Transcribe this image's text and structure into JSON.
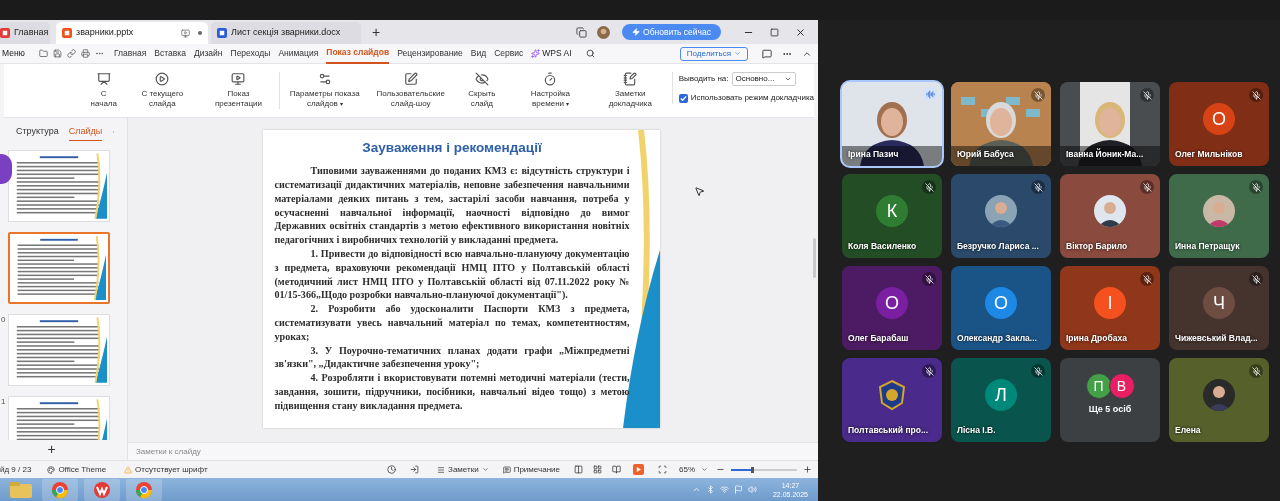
{
  "window_tabs": [
    {
      "label": "Главная",
      "selected": false,
      "kind": "wps"
    },
    {
      "label": "зварники.pptx",
      "selected": true,
      "kind": "pptx"
    },
    {
      "label": "Лист секція зварники.docx",
      "selected": false,
      "kind": "docx"
    }
  ],
  "new_tab": "+",
  "update_button": "Обновить сейчас",
  "menu_button": "Меню",
  "ribbon_tabs": [
    {
      "label": "Главная",
      "selected": false
    },
    {
      "label": "Вставка",
      "selected": false
    },
    {
      "label": "Дизайн",
      "selected": false
    },
    {
      "label": "Переходы",
      "selected": false
    },
    {
      "label": "Анимация",
      "selected": false
    },
    {
      "label": "Показ слайдов",
      "selected": true
    },
    {
      "label": "Рецензирование",
      "selected": false
    },
    {
      "label": "Вид",
      "selected": false
    },
    {
      "label": "Сервис",
      "selected": false
    }
  ],
  "ai_button": "WPS AI",
  "share_button": "Поделиться",
  "ribbon_groups": [
    [
      {
        "label": "С начала",
        "kind": "from-start"
      },
      {
        "label": "С текущего слайда",
        "kind": "from-current"
      },
      {
        "label": "Показ презентации",
        "kind": "present"
      }
    ],
    [
      {
        "label": "Параметры показа слайдов",
        "kind": "settings",
        "dropdown_mark": "▾"
      },
      {
        "label": "Пользовательские слайд-шоу",
        "kind": "custom"
      },
      {
        "label": "Скрыть слайд",
        "kind": "hide"
      },
      {
        "label": "Настройка времени",
        "kind": "timing",
        "dropdown_mark": "▾"
      },
      {
        "label": "Заметки докладчика",
        "kind": "notes"
      }
    ]
  ],
  "output": {
    "label": "Выводить на:",
    "value": "Основно..."
  },
  "presenter_mode": {
    "label": "Использовать режим докладчика",
    "checked": true
  },
  "panel_tabs": [
    {
      "label": "Структура",
      "selected": false
    },
    {
      "label": "Слайды",
      "selected": true
    }
  ],
  "thumbnails": [
    {
      "selected": false
    },
    {
      "selected": true
    },
    {
      "number": "0",
      "selected": false
    },
    {
      "number": "1",
      "selected": false
    }
  ],
  "add_slide": "+",
  "slide": {
    "title": "Зауваження і рекомендації",
    "paragraphs": [
      "Типовими зауваженнями до поданих КМЗ є: відсутність структури і систематизації дидактичних матеріалів, неповне забезпечення навчальними матеріалами деяких питань з тем, застарілі засоби навчання, потреба у осучасненні навчальної інформації, наочності відповідно до вимог Державних освітніх стандартів з метою ефективного використання новітніх педагогічних і виробничих технологій у викладанні предмета.",
      "1. Привести до відповідності всю навчально-плануючу документацію з предмета, враховуючи рекомендації НМЦ ПТО у Полтавській області (методичний лист НМЦ ПТО у Полтавській області від  07.11.2022 року № 01/15-366„Щодо розробки навчально-плануючої документації\").",
      "2. Розробити або удосконалити Паспорти КМЗ з предмета, систематизувати увесь навчальний матеріал по темах, компетентностям, уроках;",
      "3. У Поурочно-тематичних планах додати графи „Міжпредметні зв'язки\",  „Дидактичне забезпечення уроку\";",
      "4. Розробляти і вкористовувати потемні методичні матеріали (тести, завдання, зошити, підручники, посібники, навчальні відео тощо) з метою підвищення стану викладання предмета."
    ]
  },
  "notes_placeholder": "Заметки к слайду",
  "status_bar": {
    "slide": "йд 9 / 23",
    "theme": "Office Theme",
    "font_warning": "Отсутствует шрифт",
    "notes": "Заметки",
    "comment": "Примечание",
    "zoom": "65%",
    "zoom_slider": {
      "level": 0.3
    }
  },
  "taskbar": {
    "time": "14:27",
    "date": "22.05.2025"
  },
  "participants": [
    {
      "name": "Ірина Пазич",
      "kind": "video",
      "muted": false,
      "speaking": true,
      "color": "#cfd6e0"
    },
    {
      "name": "Юрий Бабуса",
      "kind": "video",
      "muted": true,
      "speaking": false,
      "color": "#b07a4a"
    },
    {
      "name": "Іванна Йоник-Ма...",
      "kind": "video",
      "muted": true,
      "speaking": false,
      "color": "#3c4043"
    },
    {
      "name": "Олег Мильніков",
      "kind": "initial",
      "initial": "О",
      "muted": true,
      "speaking": false,
      "color": "#d84315"
    },
    {
      "name": "Коля Василенко",
      "kind": "initial",
      "initial": "К",
      "muted": true,
      "speaking": false,
      "color": "#2e7d32"
    },
    {
      "name": "Безручко Лариса ...",
      "muted": true,
      "speaking": false,
      "color": "#2b4a6b"
    },
    {
      "name": "Віктор Барило",
      "muted": true,
      "speaking": false,
      "color": "#8a4a3e"
    },
    {
      "name": "Инна Петращук",
      "muted": true,
      "speaking": false,
      "color": "#3f6b4a"
    },
    {
      "name": "Олег Барабаш",
      "kind": "initial",
      "initial": "О",
      "muted": true,
      "speaking": false,
      "color": "#7b1fa2"
    },
    {
      "name": "Олександр Закла...",
      "kind": "initial",
      "initial": "О",
      "muted": false,
      "speaking": false,
      "color": "#1e88e5"
    },
    {
      "name": "Ірина Дробаха",
      "kind": "initial",
      "initial": "І",
      "muted": true,
      "speaking": false,
      "color": "#f4511e"
    },
    {
      "name": "Чижевський Влад...",
      "kind": "initial",
      "initial": "Ч",
      "muted": true,
      "speaking": false,
      "color": "#6d4c41"
    },
    {
      "name": "Полтавський про...",
      "kind": "logo",
      "muted": true,
      "speaking": false,
      "color": "#4a2a8a"
    },
    {
      "name": "Лісна І.В.",
      "kind": "initial",
      "initial": "Л",
      "muted": true,
      "speaking": false,
      "color": "#00897b"
    },
    {
      "name": "Ще 5 осіб",
      "kind": "group",
      "muted": false,
      "speaking": false,
      "color": "#3c4043",
      "avatars": [
        {
          "initial": "П",
          "color": "#43a047"
        },
        {
          "initial": "В",
          "color": "#e91e63"
        }
      ]
    },
    {
      "name": "Елена",
      "muted": true,
      "speaking": false,
      "color": "#55602a"
    }
  ]
}
